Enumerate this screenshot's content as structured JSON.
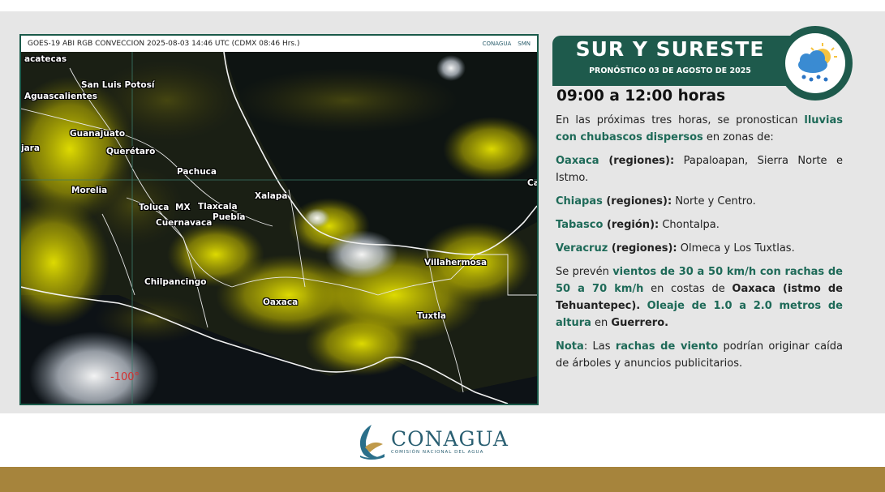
{
  "map": {
    "header": "GOES-19 ABI RGB CONVECCION 2025-08-03 14:46 UTC (CDMX  08:46 Hrs.)",
    "logo_left": "CONAGUA",
    "logo_right": "SMN",
    "longitude_label": "-100°",
    "cities": {
      "zacatecas": "acatecas",
      "slp": "San Luis Potosí",
      "ags": "Aguascalientes",
      "gto": "Guanajuato",
      "qro": "Querétaro",
      "jal": "jara",
      "pachuca": "Pachuca",
      "morelia": "Morelia",
      "toluca": "Toluca",
      "mx": "MX",
      "tlaxcala": "Tlaxcala",
      "cuernavaca": "Cuernavaca",
      "puebla": "Puebla",
      "xalapa": "Xalapa",
      "camp": "Ca",
      "villahermosa": "Villahermosa",
      "chilpancingo": "Chilpancingo",
      "oaxaca": "Oaxaca",
      "tuxtla": "Tuxtla"
    }
  },
  "forecast": {
    "region": "SUR Y SURESTE",
    "date": "PRONÓSTICO 03 DE AGOSTO DE 2025",
    "time": "09:00 a 12:00 horas",
    "icon": "rain-sun-cloud-icon",
    "p1": {
      "a": "En las próximas tres horas, se pronostican ",
      "b": "lluvias con chubascos dispersos",
      "c": " en zonas de:"
    },
    "oaxaca": {
      "state": "Oaxaca",
      "kind": " (regiones):",
      "text": " Papaloapan, Sierra Norte e Istmo."
    },
    "chiapas": {
      "state": "Chiapas",
      "kind": " (regiones):",
      "text": " Norte y Centro."
    },
    "tabasco": {
      "state": "Tabasco",
      "kind": " (región):",
      "text": " Chontalpa."
    },
    "veracruz": {
      "state": "Veracruz",
      "kind": " (regiones):",
      "text": " Olmeca y Los Tuxtlas."
    },
    "winds": {
      "a": "Se prevén ",
      "b": "vientos de 30 a 50 km/h con rachas de 50 a 70 km/h",
      "c": " en costas de ",
      "d": "Oaxaca (istmo de Tehuantepec).",
      "e": " ",
      "f": "Oleaje de 1.0 a 2.0 metros de altura",
      "g": " en ",
      "h": "Guerrero."
    },
    "note": {
      "label": "Nota",
      "a": ": Las ",
      "b": "rachas de viento",
      "c": " podrían originar caída de árboles y anuncios publicitarios."
    }
  },
  "footer": {
    "logo_word": "CONAGUA",
    "logo_sub": "COMISIÓN NACIONAL DEL AGUA"
  },
  "colors": {
    "primary": "#1e5a4c",
    "accent_gold": "#a6843c",
    "cloud_yellow": "#d8d400"
  }
}
